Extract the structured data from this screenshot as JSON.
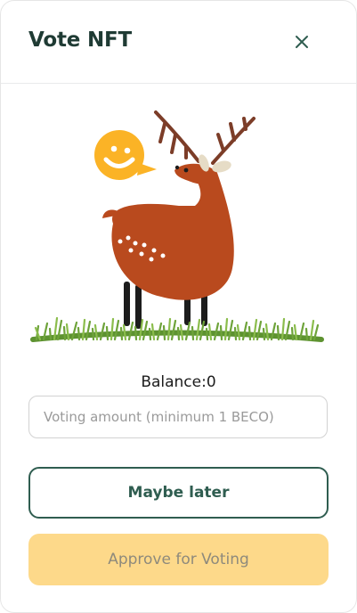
{
  "modal": {
    "title": "Vote NFT",
    "close_icon": "close-icon"
  },
  "balance": {
    "text": "Balance:0"
  },
  "voting_input": {
    "value": "",
    "placeholder": "Voting amount (minimum 1 BECO)"
  },
  "buttons": {
    "maybe_later": "Maybe later",
    "approve": "Approve for Voting"
  },
  "colors": {
    "accent": "#2f5d50",
    "approve_bg": "#fdd98a",
    "deer": "#b94a1e",
    "grass": "#6ea33a",
    "bubble": "#fbb326"
  }
}
